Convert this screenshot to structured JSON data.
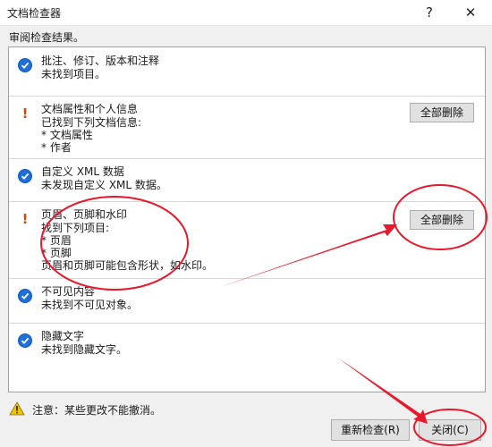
{
  "window": {
    "title": "文档检查器",
    "help_label": "?",
    "close_label": "✕"
  },
  "subtitle": "审阅检查结果。",
  "sections": [
    {
      "status": "ok",
      "title": "批注、修订、版本和注释",
      "lines": [
        "未找到项目。"
      ]
    },
    {
      "status": "found",
      "title": "文档属性和个人信息",
      "lines": [
        "已找到下列文档信息:",
        "* 文档属性",
        "* 作者"
      ],
      "button": "全部删除"
    },
    {
      "status": "ok",
      "title": "自定义 XML 数据",
      "lines": [
        "未发现自定义 XML 数据。"
      ]
    },
    {
      "status": "found",
      "title": "页眉、页脚和水印",
      "lines": [
        "找到下列项目:",
        "* 页眉",
        "* 页脚",
        "页眉和页脚可能包含形状，如水印。"
      ],
      "button": "全部删除"
    },
    {
      "status": "ok",
      "title": "不可见内容",
      "lines": [
        "未找到不可见对象。"
      ]
    },
    {
      "status": "ok",
      "title": "隐藏文字",
      "lines": [
        "未找到隐藏文字。"
      ]
    }
  ],
  "footer": {
    "note": "注意：某些更改不能撤消。",
    "reinspect_label": "重新检查(R)",
    "close_label": "关闭(C)"
  },
  "colors": {
    "check": "#1e6fd9",
    "exclamation": "#d6480b",
    "annotation": "#e8192c",
    "warning": "#f2c300"
  },
  "icons": {
    "ok": "check-circle-icon",
    "found": "exclamation-icon",
    "note": "warning-triangle-icon"
  }
}
